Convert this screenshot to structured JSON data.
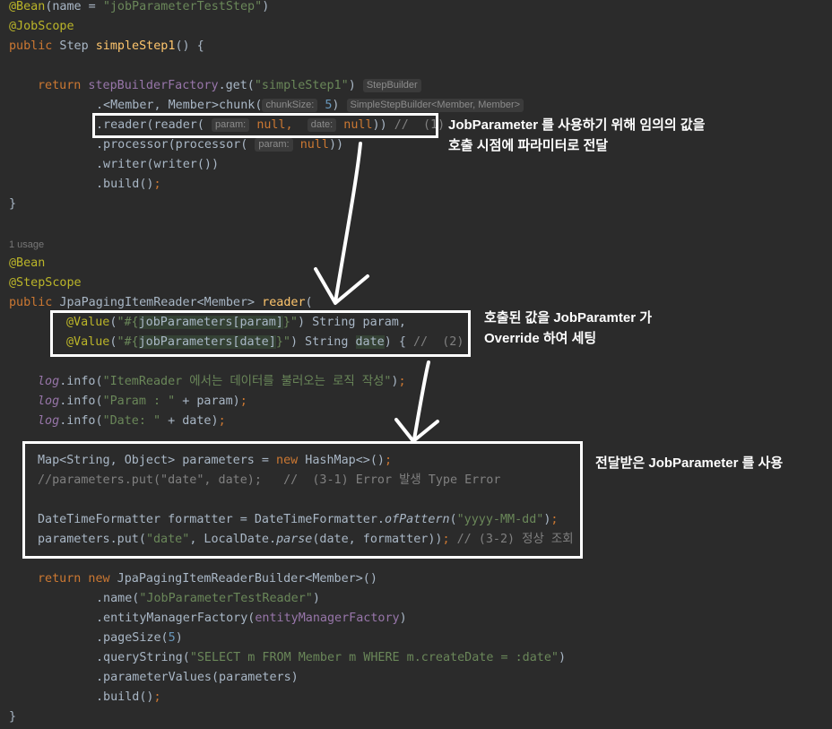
{
  "code": {
    "l1": {
      "ann": "@Bean",
      "open": "(name = ",
      "str": "\"jobParameterTestStep\"",
      "close": ")"
    },
    "l2": {
      "ann": "@JobScope"
    },
    "l3": {
      "kw": "public",
      "type": " Step ",
      "fn": "simpleStep1",
      "rest": "() {"
    },
    "l5": {
      "kw": "return",
      "field": " stepBuilderFactory",
      "dot": ".get(",
      "str": "\"simpleStep1\"",
      "close": ")",
      "hint": "StepBuilder"
    },
    "l6": {
      "pre": ".<Member, Member>chunk(",
      "hint_name": "chunkSize:",
      "num": "5",
      "close": ")",
      "hint_type": "SimpleStepBuilder<Member, Member>"
    },
    "l7": {
      "pre": ".reader(reader(",
      "hint_param": "param:",
      "null1": "null,",
      "hint_date": "date:",
      "null2": "null",
      "close": ")) ",
      "comment": "//  (1)"
    },
    "l8": {
      "pre": ".processor(processor(",
      "hint_param": "param:",
      "null1": "null",
      "close": "))"
    },
    "l9": {
      "pre": ".writer(writer())"
    },
    "l10": {
      "pre": ".build()",
      "semi": ";"
    },
    "l11": {
      "brace": "}"
    },
    "usage": "1 usage",
    "l13": {
      "ann": "@Bean"
    },
    "l14": {
      "ann": "@StepScope"
    },
    "l15": {
      "kw": "public",
      "type": " JpaPagingItemReader<Member> ",
      "fn": "reader",
      "rest": "("
    },
    "l16": {
      "ann": "@Value",
      "open": "(",
      "s1": "\"#{",
      "var": "jobParameters[param]",
      "s2": "}\"",
      "rest": ") String param,"
    },
    "l17": {
      "ann": "@Value",
      "open": "(",
      "s1": "\"#{",
      "var": "jobParameters[date]",
      "s2": "}\"",
      "rest": ") String ",
      "date": "date",
      ") {": ") {",
      "comment": " //  (2)"
    },
    "l19": {
      "field": "log",
      ".info(": ".info(",
      "str": "\"ItemReader 에서는 데이터를 불러오는 로직 작성\"",
      "close": ")",
      "semi": ";"
    },
    "l20": {
      "field": "log",
      ".info(": ".info(",
      "str": "\"Param : \"",
      "rest": " + param)",
      "semi": ";"
    },
    "l21": {
      "field": "log",
      ".info(": ".info(",
      "str": "\"Date: \"",
      "rest": " + date)",
      "semi": ";"
    },
    "l23": {
      "pre": "Map<String, Object> parameters = ",
      "kw": "new",
      "rest": " HashMap<>()",
      "semi": ";"
    },
    "l24": {
      "comment": "//parameters.put(\"date\", date);   //  (3-1) Error 발생 Type Error"
    },
    "l26": {
      "pre": "DateTimeFormatter formatter = DateTimeFormatter.",
      "ital": "ofPattern",
      "open": "(",
      "str": "\"yyyy-MM-dd\"",
      "close": ")",
      "semi": ";"
    },
    "l27": {
      "pre": "parameters.put(",
      "str": "\"date\"",
      "mid": ", LocalDate.",
      "ital": "parse",
      "rest": "(date, formatter))",
      "semi": ";",
      "comment": " // (3-2) 정상 조회"
    },
    "l29": {
      "kw": "return new",
      "rest": " JpaPagingItemReaderBuilder<Member>()"
    },
    "l30": {
      "pre": ".name(",
      "str": "\"JobParameterTestReader\"",
      "close": ")"
    },
    "l31": {
      "pre": ".entityManagerFactory(",
      "field": "entityManagerFactory",
      "close": ")"
    },
    "l32": {
      "pre": ".pageSize(",
      "num": "5",
      "close": ")"
    },
    "l33": {
      "pre": ".queryString(",
      "str": "\"SELECT m FROM Member m WHERE m.createDate = :date\"",
      "close": ")"
    },
    "l34": {
      "pre": ".parameterValues(parameters)"
    },
    "l35": {
      "pre": ".build()",
      "semi": ";"
    },
    "l36": {
      "brace": "}"
    }
  },
  "callouts": {
    "c1_line1": "JobParameter 를 사용하기 위해 임의의 값을",
    "c1_line2": "호출 시점에 파라미터로 전달",
    "c2_line1": "호출된 값을 JobParamter 가",
    "c2_line2": "Override 하여 세팅",
    "c3_line1": "전달받은 JobParameter 를 사용"
  },
  "colors": {
    "background": "#2b2b2b",
    "annotation": "#bbb529",
    "keyword": "#cc7832",
    "string": "#6a8759",
    "number": "#6897bb",
    "function": "#ffc66d",
    "comment": "#808080",
    "field": "#9876aa",
    "highlight": "#ffffff"
  }
}
